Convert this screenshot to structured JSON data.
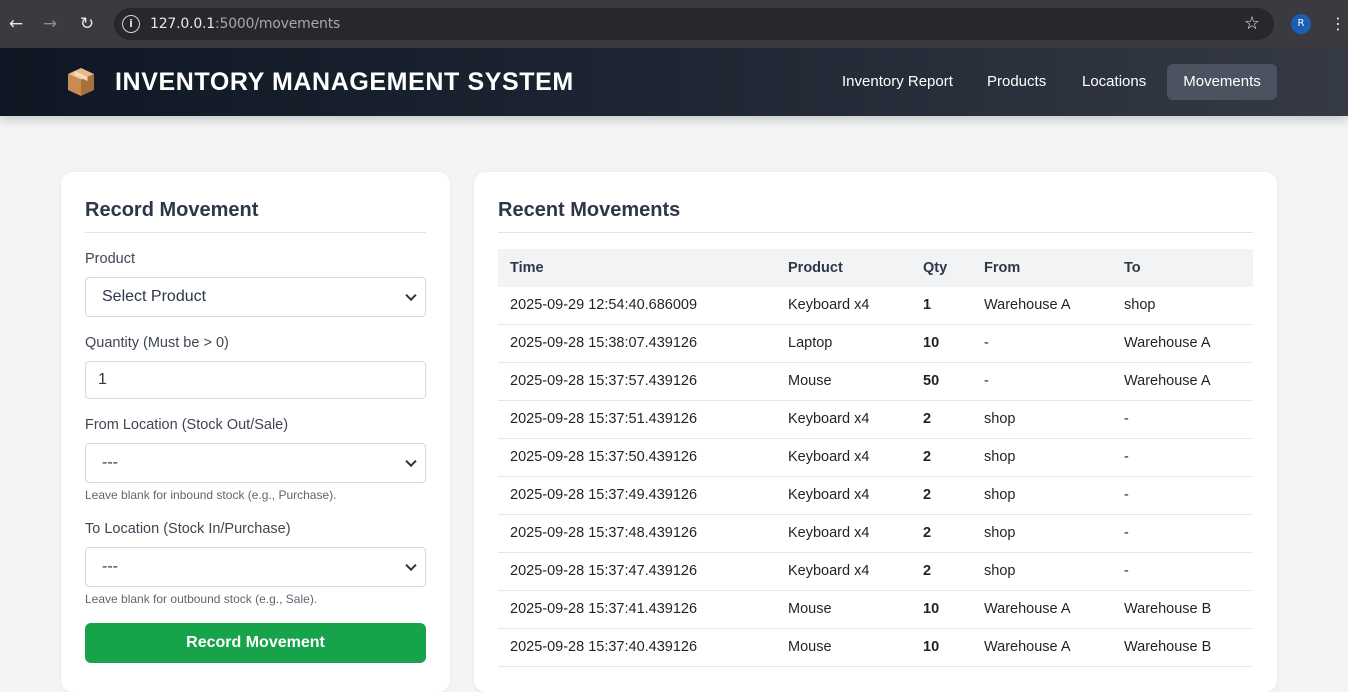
{
  "browser": {
    "url_host": "127.0.0.1",
    "url_path": ":5000/movements",
    "profile_initial": "R"
  },
  "header": {
    "title": "INVENTORY MANAGEMENT SYSTEM",
    "nav": [
      {
        "label": "Inventory Report"
      },
      {
        "label": "Products"
      },
      {
        "label": "Locations"
      },
      {
        "label": "Movements"
      }
    ],
    "active_nav": "Movements"
  },
  "form": {
    "title": "Record Movement",
    "product_label": "Product",
    "product_value": "Select Product",
    "quantity_label": "Quantity (Must be > 0)",
    "quantity_value": "1",
    "from_label": "From Location (Stock Out/Sale)",
    "from_value": "---",
    "from_hint": "Leave blank for inbound stock (e.g., Purchase).",
    "to_label": "To Location (Stock In/Purchase)",
    "to_value": "---",
    "to_hint": "Leave blank for outbound stock (e.g., Sale).",
    "submit_label": "Record Movement"
  },
  "movements": {
    "title": "Recent Movements",
    "columns": [
      "Time",
      "Product",
      "Qty",
      "From",
      "To"
    ],
    "rows": [
      {
        "time": "2025-09-29 12:54:40.686009",
        "product": "Keyboard x4",
        "qty": "1",
        "from": "Warehouse A",
        "to": "shop"
      },
      {
        "time": "2025-09-28 15:38:07.439126",
        "product": "Laptop",
        "qty": "10",
        "from": "-",
        "to": "Warehouse A"
      },
      {
        "time": "2025-09-28 15:37:57.439126",
        "product": "Mouse",
        "qty": "50",
        "from": "-",
        "to": "Warehouse A"
      },
      {
        "time": "2025-09-28 15:37:51.439126",
        "product": "Keyboard x4",
        "qty": "2",
        "from": "shop",
        "to": "-"
      },
      {
        "time": "2025-09-28 15:37:50.439126",
        "product": "Keyboard x4",
        "qty": "2",
        "from": "shop",
        "to": "-"
      },
      {
        "time": "2025-09-28 15:37:49.439126",
        "product": "Keyboard x4",
        "qty": "2",
        "from": "shop",
        "to": "-"
      },
      {
        "time": "2025-09-28 15:37:48.439126",
        "product": "Keyboard x4",
        "qty": "2",
        "from": "shop",
        "to": "-"
      },
      {
        "time": "2025-09-28 15:37:47.439126",
        "product": "Keyboard x4",
        "qty": "2",
        "from": "shop",
        "to": "-"
      },
      {
        "time": "2025-09-28 15:37:41.439126",
        "product": "Mouse",
        "qty": "10",
        "from": "Warehouse A",
        "to": "Warehouse B"
      },
      {
        "time": "2025-09-28 15:37:40.439126",
        "product": "Mouse",
        "qty": "10",
        "from": "Warehouse A",
        "to": "Warehouse B"
      }
    ]
  }
}
